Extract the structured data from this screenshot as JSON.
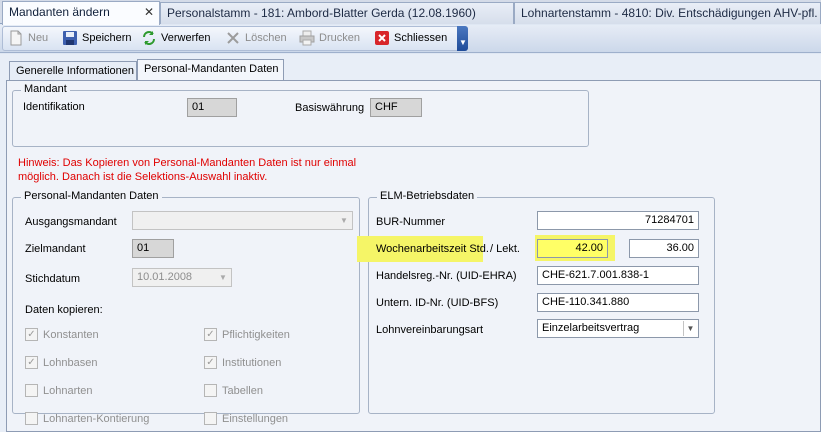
{
  "doc_tabs": [
    {
      "label": "Mandanten ändern",
      "active": true
    },
    {
      "label": "Personalstamm - 181: Ambord-Blatter Gerda (12.08.1960)",
      "active": false
    },
    {
      "label": "Lohnartenstamm - 4810: Div. Entschädigungen AHV-pfl.",
      "active": false
    }
  ],
  "toolbar": {
    "new_label": "Neu",
    "save_label": "Speichern",
    "discard_label": "Verwerfen",
    "delete_label": "Löschen",
    "print_label": "Drucken",
    "close_label": "Schliessen"
  },
  "sub_tabs": [
    {
      "label": "Generelle Informationen",
      "active": false
    },
    {
      "label": "Personal-Mandanten Daten",
      "active": true
    }
  ],
  "mandant": {
    "legend": "Mandant",
    "id_label": "Identifikation",
    "id_value": "01",
    "currency_label": "Basiswährung",
    "currency_value": "CHF"
  },
  "warning": {
    "line1": "Hinweis: Das Kopieren von Personal-Mandanten Daten ist nur einmal",
    "line2": "möglich. Danach ist die Selektions-Auswahl inaktiv."
  },
  "personal": {
    "legend": "Personal-Mandanten Daten",
    "source_label": "Ausgangsmandant",
    "source_value": "",
    "target_label": "Zielmandant",
    "target_value": "01",
    "date_label": "Stichdatum",
    "date_value": "10.01.2008",
    "copy_label": "Daten kopieren:",
    "checkboxes": [
      {
        "label": "Konstanten",
        "checked": true
      },
      {
        "label": "Pflichtigkeiten",
        "checked": true
      },
      {
        "label": "Lohnbasen",
        "checked": true
      },
      {
        "label": "Institutionen",
        "checked": true
      },
      {
        "label": "Lohnarten",
        "checked": false
      },
      {
        "label": "Tabellen",
        "checked": false
      },
      {
        "label": "Lohnarten-Kontierung",
        "checked": false
      },
      {
        "label": "Einstellungen",
        "checked": false
      }
    ]
  },
  "elm": {
    "legend": "ELM-Betriebsdaten",
    "bur_label": "BUR-Nummer",
    "bur_value": "71284701",
    "hours_label": "Wochenarbeitszeit Std.",
    "lekt_label": "/ Lekt.",
    "hours_value": "42.00",
    "lekt_value": "36.00",
    "uid_ehra_label": "Handelsreg.-Nr. (UID-EHRA)",
    "uid_ehra_value": "CHE-621.7.001.838-1",
    "uid_bfs_label": "Untern. ID-Nr. (UID-BFS)",
    "uid_bfs_value": "CHE-110.341.880",
    "contract_label": "Lohnvereinbarungsart",
    "contract_value": "Einzelarbeitsvertrag"
  },
  "colors": {
    "highlight": "#ffff66",
    "warning": "#e00000"
  }
}
